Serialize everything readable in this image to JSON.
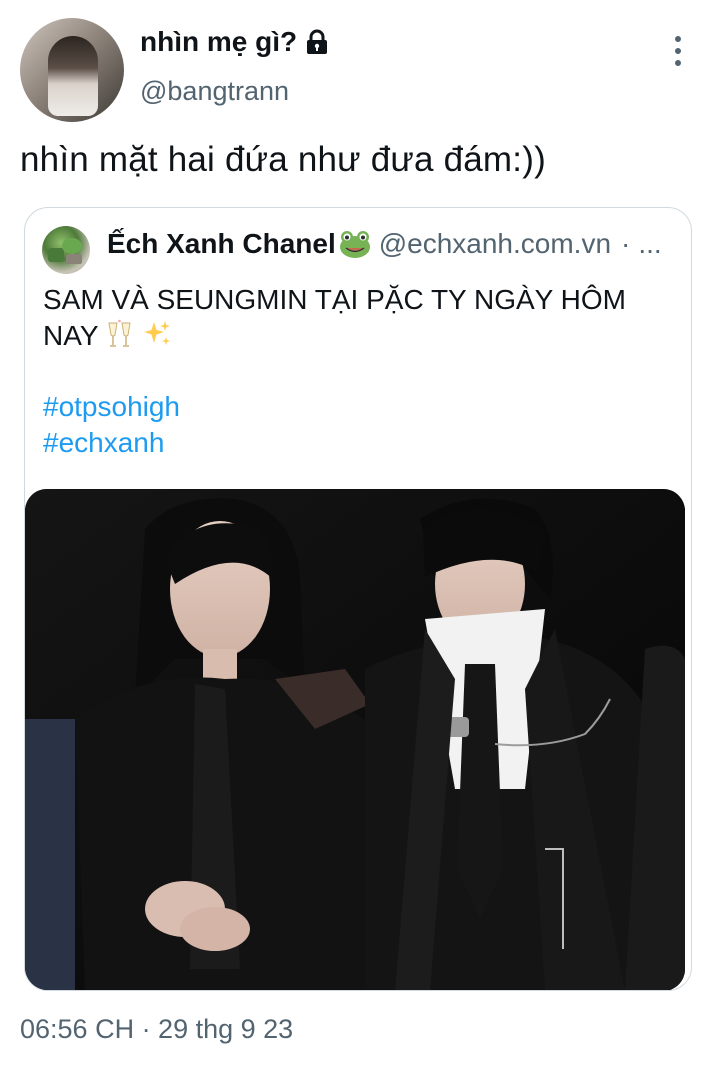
{
  "tweet": {
    "display_name": "nhìn mẹ gì?",
    "handle": "@bangtrann",
    "text": "nhìn mặt hai đứa như đưa đám:))",
    "timestamp": "06:56 CH · 29 thg 9 23",
    "icons": {
      "lock": "lock-icon",
      "more": "more-options-icon"
    }
  },
  "quote": {
    "display_name": "Ếch Xanh Chanel",
    "handle": "@echxanh.com.vn",
    "separator": "·",
    "ellipsis": "...",
    "text": "SAM VÀ SEUNGMIN TẠI PẶC TY NGÀY HÔM NAY",
    "hashtags": [
      "#otpsohigh",
      "#echxanh"
    ],
    "icons": {
      "frog": "frog-icon",
      "glasses": "clinking-glasses-icon",
      "sparkles": "sparkles-icon"
    }
  },
  "colors": {
    "text_primary": "#0f1419",
    "text_secondary": "#536471",
    "link": "#1d9bf0",
    "border": "#cfd9de"
  }
}
